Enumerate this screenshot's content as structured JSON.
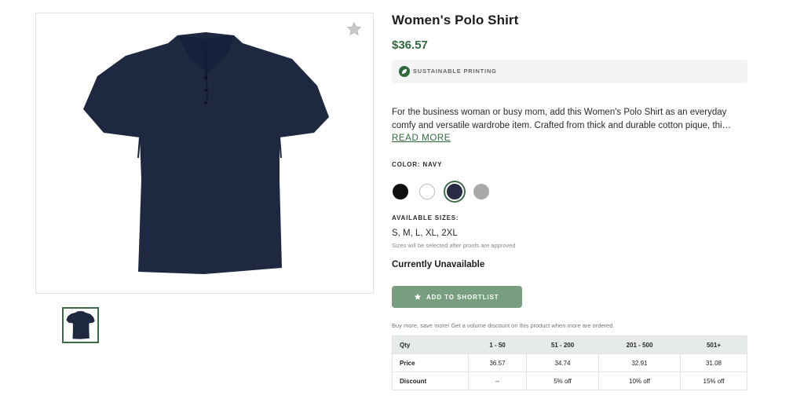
{
  "product": {
    "title": "Women's Polo Shirt",
    "price": "$36.57",
    "badge": "SUSTAINABLE PRINTING",
    "description_line1": "For the business woman or busy mom, add this Women's Polo Shirt as an everyday",
    "description_line2": "comfy and versatile wardrobe item. Crafted from thick and durable cotton pique, thi…",
    "read_more": "READ MORE",
    "color_label": "COLOR: NAVY",
    "colors": [
      {
        "name": "black",
        "hex": "#0f0f0f"
      },
      {
        "name": "white",
        "hex": "#ffffff"
      },
      {
        "name": "navy",
        "hex": "#2b2a44",
        "selected": true
      },
      {
        "name": "gray",
        "hex": "#a9a9a9"
      }
    ],
    "sizes_label": "AVAILABLE SIZES:",
    "sizes": "S, M, L, XL, 2XL",
    "sizes_note": "Sizes will be selected after proofs are approved",
    "availability": "Currently Unavailable",
    "shortlist_button": "ADD TO SHORTLIST",
    "volume_note": "Buy more, save more! Get a volume discount on this product when more are ordered."
  },
  "discount_table": {
    "headers": [
      "Qty",
      "1 - 50",
      "51 - 200",
      "201 - 500",
      "501+"
    ],
    "price_row": [
      "Price",
      "36.57",
      "34.74",
      "32.91",
      "31.08"
    ],
    "discount_row": [
      "Discount",
      "--",
      "5% off",
      "10% off",
      "15% off"
    ]
  },
  "colors": {
    "accent_green": "#2e6a3c",
    "button_green": "#779e7f",
    "shirt_navy": "#1e2840"
  },
  "icons": [
    "favorite-star-icon",
    "leaf-icon",
    "star-icon"
  ]
}
